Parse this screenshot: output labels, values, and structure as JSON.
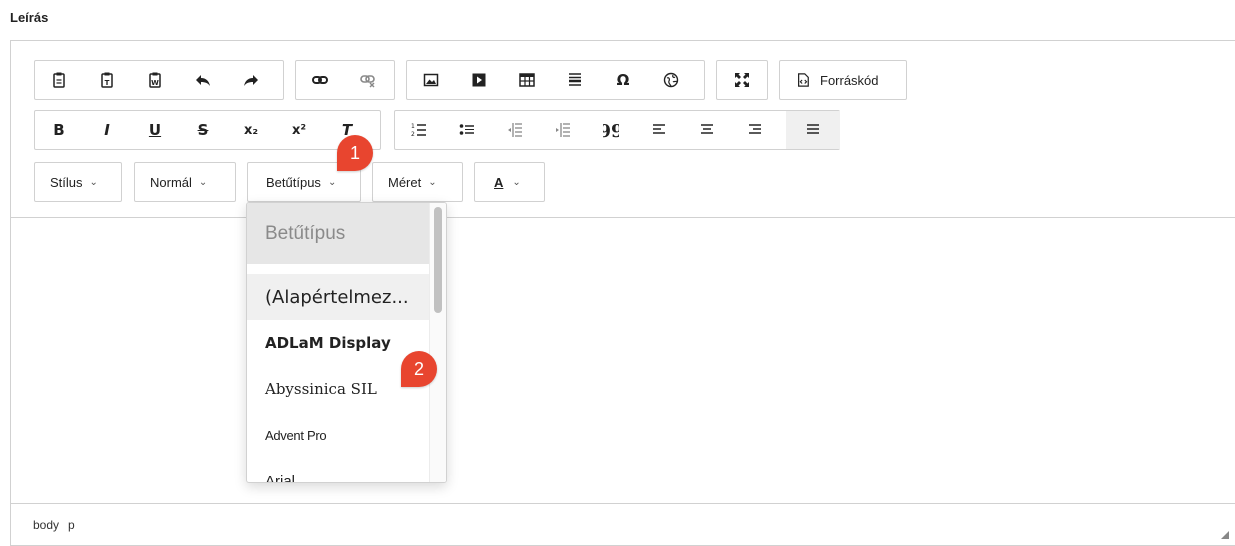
{
  "field_label": "Leírás",
  "toolbar": {
    "row1_group1": [
      "Beillesztés",
      "Beillesztés szövegként",
      "Beillesztés Wordből",
      "Visszavonás",
      "Újra"
    ],
    "row1_group2": [
      "Hivatkozás",
      "Hivatkozás törlése"
    ],
    "row1_group3": [
      "Kép",
      "Videó",
      "Táblázat",
      "Vízszintes vonal",
      "Speciális karakter",
      "Iframe"
    ],
    "row1_group4": [
      "Teljes képernyő"
    ],
    "source_label": "Forráskód",
    "format_group": [
      "B",
      "I",
      "U",
      "S",
      "x₂",
      "x²",
      "T"
    ],
    "paragraph_group": [
      "Számozott lista",
      "Felsorolás",
      "Behúzás csökkentése",
      "Behúzás növelése",
      "Idézet",
      "Balra igazítás",
      "Középre igazítás",
      "Jobbra igazítás",
      "Sorkizárt"
    ],
    "quote_glyph": "99"
  },
  "combos": {
    "style": "Stílus",
    "format": "Normál",
    "font": "Betűtípus",
    "size": "Méret",
    "color": "A"
  },
  "dropdown": {
    "header": "Betűtípus",
    "items": [
      "(Alapértelmez...",
      "ADLaM Display",
      "Abyssinica SIL",
      "Advent Pro",
      "Arial"
    ]
  },
  "statusbar": {
    "path": [
      "body",
      "p"
    ]
  },
  "badges": [
    "1",
    "2"
  ],
  "colors": {
    "border": "#d1d1d1",
    "badge": "#e8452f",
    "header_bg": "#e6e6e6"
  }
}
